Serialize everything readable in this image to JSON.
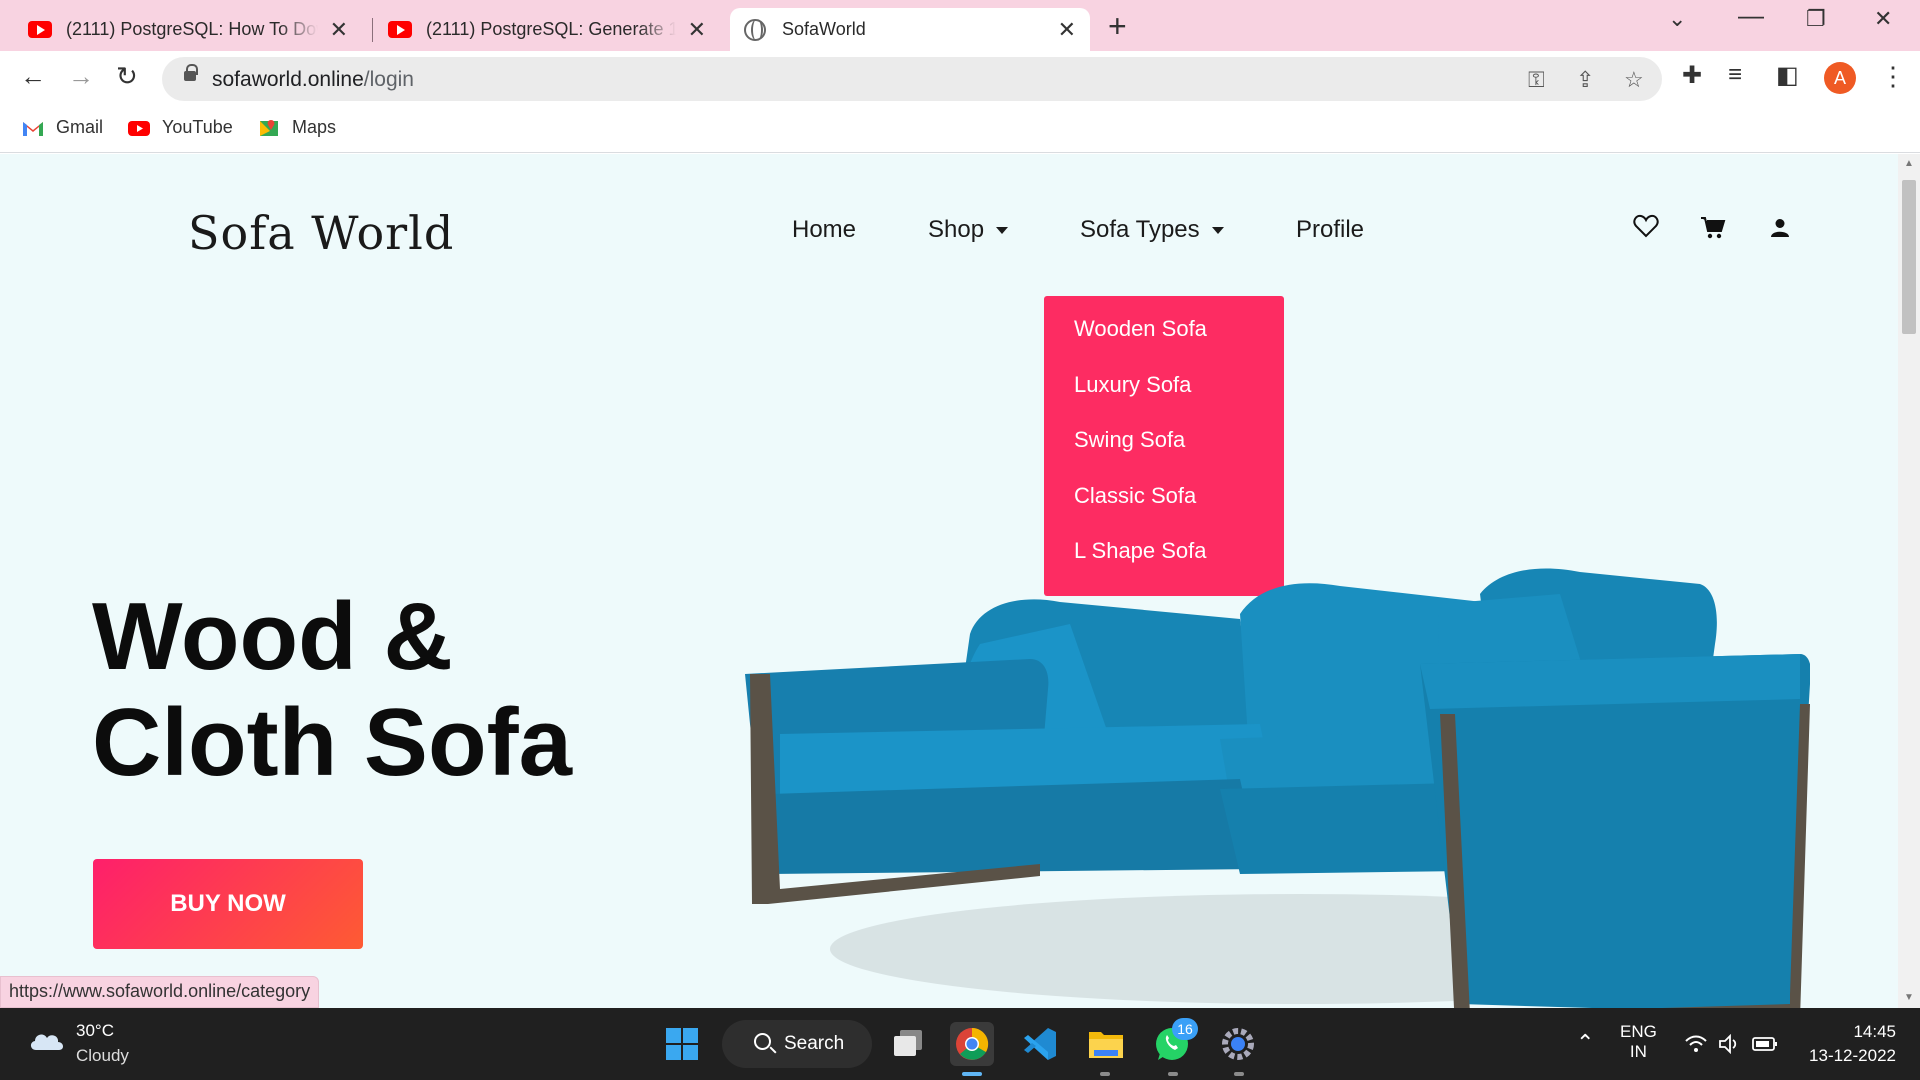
{
  "browser": {
    "tabs": [
      {
        "title": "(2111) PostgreSQL: How To Download",
        "icon": "youtube-icon",
        "active": false
      },
      {
        "title": "(2111) PostgreSQL: Generate 100",
        "icon": "youtube-icon",
        "active": false
      },
      {
        "title": "SofaWorld",
        "icon": "globe-icon",
        "active": true
      }
    ],
    "url_host": "sofaworld.online",
    "url_path": "/login",
    "profile_initial": "A",
    "bookmarks": [
      {
        "label": "Gmail",
        "icon": "gmail-icon"
      },
      {
        "label": "YouTube",
        "icon": "youtube-icon"
      },
      {
        "label": "Maps",
        "icon": "maps-icon"
      }
    ],
    "status_url": "https://www.sofaworld.online/category"
  },
  "site": {
    "logo": "Sofa World",
    "nav": {
      "home": "Home",
      "shop": "Shop",
      "sofa_types": "Sofa Types",
      "profile": "Profile"
    },
    "dropdown": [
      "Wooden Sofa",
      "Luxury Sofa",
      "Swing Sofa",
      "Classic Sofa",
      "L Shape Sofa"
    ],
    "hero": {
      "title_line1": "Wood &",
      "title_line2": "Cloth Sofa",
      "cta": "BUY NOW"
    },
    "colors": {
      "accent": "#fd2c62",
      "page_bg": "#eefafb",
      "sofa": "#1a8fc0"
    }
  },
  "taskbar": {
    "weather_temp": "30°C",
    "weather_condition": "Cloudy",
    "search_label": "Search",
    "whatsapp_badge": "16",
    "lang_line1": "ENG",
    "lang_line2": "IN",
    "time": "14:45",
    "date": "13-12-2022"
  }
}
